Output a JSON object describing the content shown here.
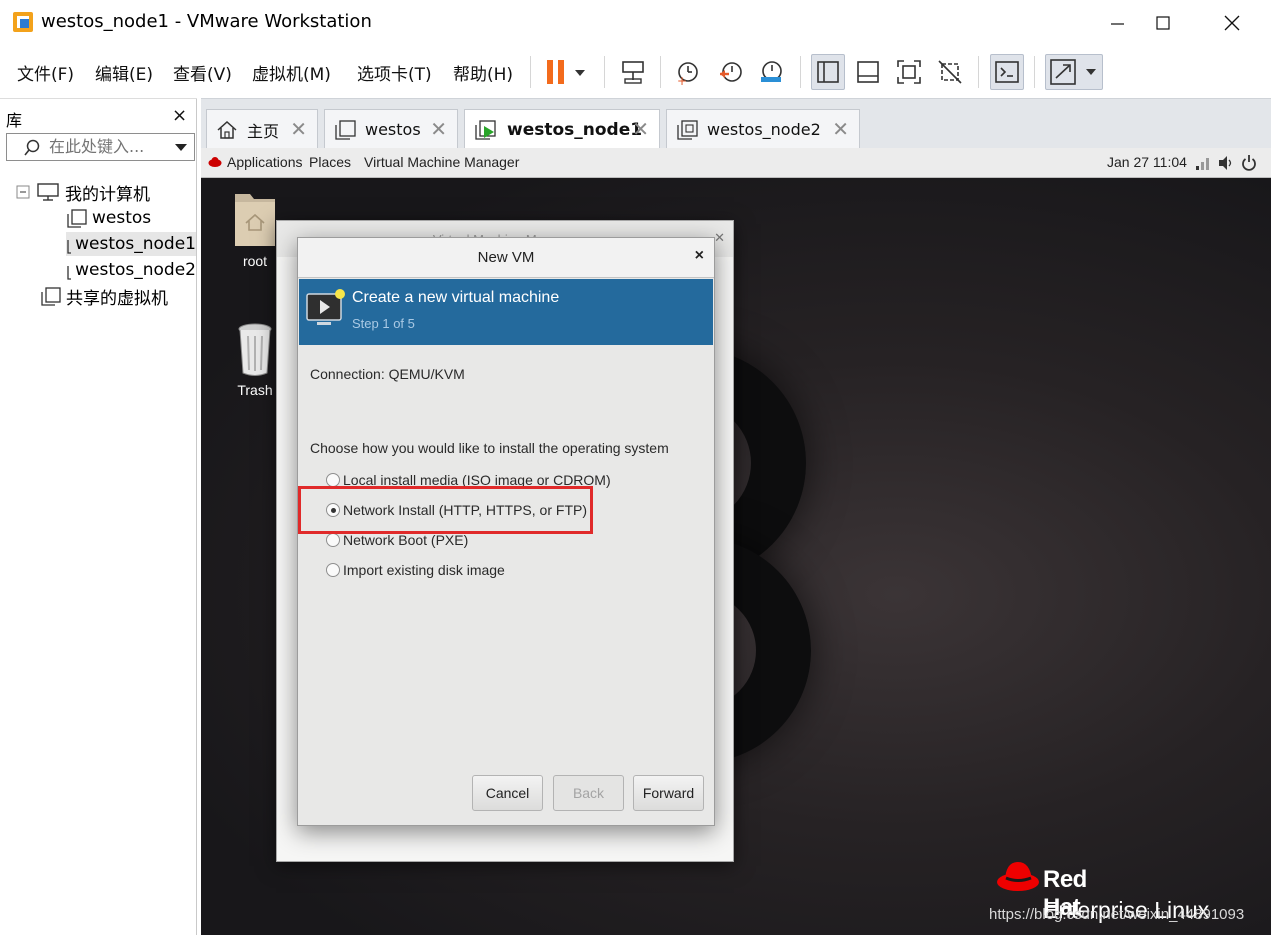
{
  "window": {
    "title": "westos_node1 - VMware Workstation"
  },
  "menu": {
    "items": [
      "文件(F)",
      "编辑(E)",
      "查看(V)",
      "虚拟机(M)",
      "选项卡(T)",
      "帮助(H)"
    ]
  },
  "library": {
    "title": "库",
    "close": "×",
    "search_placeholder": "在此处键入...",
    "tree": {
      "root_label": "我的计算机",
      "items": [
        "westos",
        "westos_node1",
        "westos_node2"
      ],
      "shared_label": "共享的虚拟机"
    }
  },
  "tabs": [
    {
      "label": "主页",
      "active": false
    },
    {
      "label": "westos",
      "active": false
    },
    {
      "label": "westos_node1",
      "active": true
    },
    {
      "label": "westos_node2",
      "active": false
    }
  ],
  "guest": {
    "topbar": {
      "applications": "Applications",
      "places": "Places",
      "vmm": "Virtual Machine Manager",
      "clock": "Jan 27  11:04"
    },
    "desktop_icons": {
      "home": "root",
      "trash": "Trash"
    },
    "bg_window": {
      "title": "Virtual Machine Manager"
    },
    "dialog": {
      "title": "New VM",
      "close": "×",
      "header_title": "Create a new virtual machine",
      "header_step": "Step 1 of 5",
      "connection": "Connection:  QEMU/KVM",
      "question": "Choose how you would like to install the operating system",
      "options": [
        {
          "label": "Local install media (ISO image or CDROM)",
          "checked": false
        },
        {
          "label": "Network Install (HTTP, HTTPS, or FTP)",
          "checked": true
        },
        {
          "label": "Network Boot (PXE)",
          "checked": false
        },
        {
          "label": "Import existing disk image",
          "checked": false
        }
      ],
      "buttons": {
        "cancel": "Cancel",
        "back": "Back",
        "forward": "Forward"
      }
    },
    "logo": {
      "line1": "Red Hat",
      "line2": "Enterprise Linux"
    },
    "watermark": "https://blog.csdn.net/weixin_44891093"
  }
}
